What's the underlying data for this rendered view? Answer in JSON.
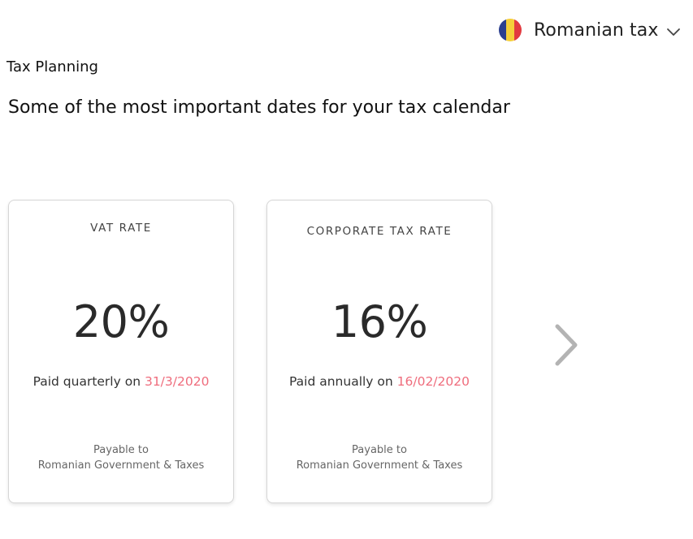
{
  "country_select": {
    "label": "Romanian tax",
    "flag_colors": [
      "#2b3f8f",
      "#f5cf3a",
      "#e23a40"
    ]
  },
  "section_label": "Tax Planning",
  "subtitle": "Some of the most important dates for your tax calendar",
  "cards": [
    {
      "title": "VAT RATE",
      "rate": "20%",
      "paid_prefix": "Paid quarterly on ",
      "paid_date": "31/3/2020",
      "payable_line1": "Payable to",
      "payable_line2": "Romanian Government & Taxes"
    },
    {
      "title": "CORPORATE TAX RATE",
      "rate": "16%",
      "paid_prefix": "Paid annually on ",
      "paid_date": "16/02/2020",
      "payable_line1": "Payable to",
      "payable_line2": "Romanian Government & Taxes"
    }
  ],
  "colors": {
    "date_accent": "#ef6d7d",
    "arrow": "#b3b3b3"
  },
  "icons": {
    "dropdown": "chevron-down-icon",
    "next": "chevron-right-icon"
  }
}
